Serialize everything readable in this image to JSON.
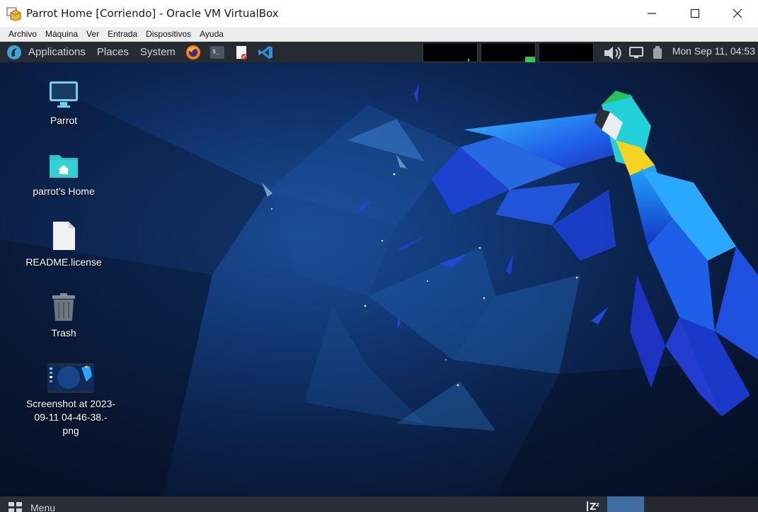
{
  "window": {
    "title": "Parrot Home [Corriendo] - Oracle VM VirtualBox",
    "controls": {
      "minimize": "—",
      "maximize": "☐",
      "close": "✕"
    }
  },
  "vbox_menu": [
    "Archivo",
    "Máquina",
    "Ver",
    "Entrada",
    "Dispositivos",
    "Ayuda"
  ],
  "panel": {
    "menus": [
      "Applications",
      "Places",
      "System"
    ],
    "launchers": [
      "firefox-icon",
      "terminal-icon",
      "text-editor-icon",
      "vscode-icon"
    ],
    "clock": "Mon Sep 11, 04:53"
  },
  "desktop_icons": [
    {
      "label": "Parrot",
      "icon": "computer-icon"
    },
    {
      "label": "parrot's Home",
      "icon": "home-folder-icon"
    },
    {
      "label": "README.license",
      "icon": "document-icon"
    },
    {
      "label": "Trash",
      "icon": "trash-icon"
    },
    {
      "label": "Screenshot at 2023-09-11 04-46-38.-png",
      "label_lines": [
        "Screenshot at 2023-",
        "09-11 04-46-38.-",
        "png"
      ],
      "icon": "image-thumbnail"
    }
  ],
  "bottom_panel": {
    "menu_label": "Menu"
  },
  "colors": {
    "panel": "#262a31",
    "desktop": "#123a78",
    "accent": "#3aa4d6",
    "folder": "#2bc3c9"
  }
}
